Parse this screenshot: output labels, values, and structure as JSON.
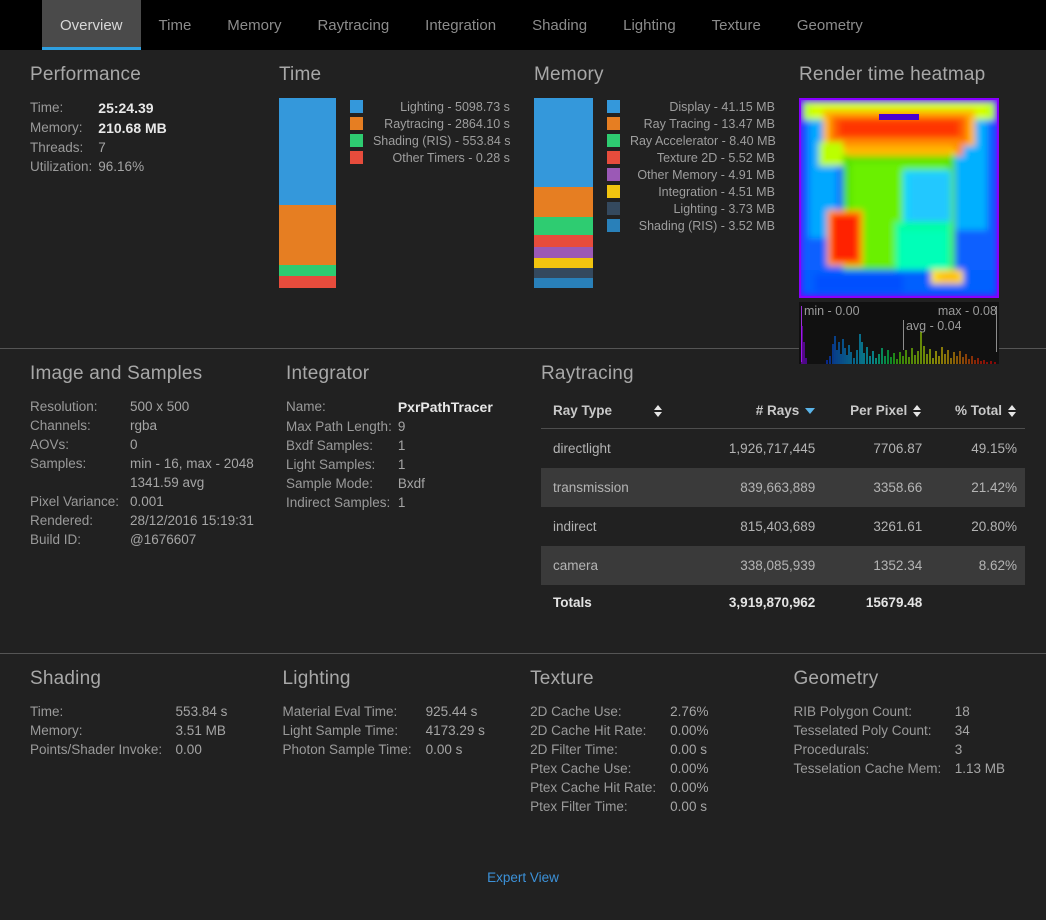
{
  "tabs": [
    {
      "label": "Overview",
      "active": true
    },
    {
      "label": "Time",
      "active": false
    },
    {
      "label": "Memory",
      "active": false
    },
    {
      "label": "Raytracing",
      "active": false
    },
    {
      "label": "Integration",
      "active": false
    },
    {
      "label": "Shading",
      "active": false
    },
    {
      "label": "Lighting",
      "active": false
    },
    {
      "label": "Texture",
      "active": false
    },
    {
      "label": "Geometry",
      "active": false
    }
  ],
  "performance": {
    "title": "Performance",
    "rows": [
      {
        "key": "Time:",
        "value": "25:24.39",
        "bold": true
      },
      {
        "key": "Memory:",
        "value": "210.68 MB",
        "bold": true
      },
      {
        "key": "Threads:",
        "value": "7",
        "bold": false
      },
      {
        "key": "Utilization:",
        "value": "96.16%",
        "bold": false
      }
    ]
  },
  "time_panel": {
    "title": "Time"
  },
  "memory_panel": {
    "title": "Memory"
  },
  "heatmap": {
    "title": "Render time heatmap",
    "min_label": "min - 0.00",
    "max_label": "max - 0.08",
    "avg_label": "avg - 0.04"
  },
  "image_samples": {
    "title": "Image and Samples",
    "rows": [
      {
        "key": "Resolution:",
        "value": "500 x 500"
      },
      {
        "key": "Channels:",
        "value": "rgba"
      },
      {
        "key": "AOVs:",
        "value": "0"
      },
      {
        "key": "Samples:",
        "value": "min - 16, max - 2048"
      },
      {
        "key": "",
        "value": "1341.59 avg"
      },
      {
        "key": "Pixel Variance:",
        "value": "0.001"
      },
      {
        "key": "Rendered:",
        "value": "28/12/2016 15:19:31"
      },
      {
        "key": "Build ID:",
        "value": "@1676607"
      }
    ]
  },
  "integrator": {
    "title": "Integrator",
    "rows": [
      {
        "key": "Name:",
        "value": "PxrPathTracer",
        "bold": true
      },
      {
        "key": "Max Path Length:",
        "value": "9",
        "bold": false
      },
      {
        "key": "Bxdf Samples:",
        "value": "1",
        "bold": false
      },
      {
        "key": "Light Samples:",
        "value": "1",
        "bold": false
      },
      {
        "key": "Sample Mode:",
        "value": "Bxdf",
        "bold": false
      },
      {
        "key": "Indirect Samples:",
        "value": "1",
        "bold": false
      }
    ]
  },
  "raytracing": {
    "title": "Raytracing",
    "columns": [
      {
        "label": "Ray Type",
        "sort": "both"
      },
      {
        "label": "# Rays",
        "sort": "desc"
      },
      {
        "label": "Per Pixel",
        "sort": "both"
      },
      {
        "label": "% Total",
        "sort": "both"
      }
    ],
    "rows": [
      {
        "ray_type": "directlight",
        "rays": "1,926,717,445",
        "per_pixel": "7706.87",
        "pct_total": "49.15%"
      },
      {
        "ray_type": "transmission",
        "rays": "839,663,889",
        "per_pixel": "3358.66",
        "pct_total": "21.42%"
      },
      {
        "ray_type": "indirect",
        "rays": "815,403,689",
        "per_pixel": "3261.61",
        "pct_total": "20.80%"
      },
      {
        "ray_type": "camera",
        "rays": "338,085,939",
        "per_pixel": "1352.34",
        "pct_total": "8.62%"
      }
    ],
    "totals": {
      "label": "Totals",
      "rays": "3,919,870,962",
      "per_pixel": "15679.48",
      "pct_total": ""
    }
  },
  "shading": {
    "title": "Shading",
    "rows": [
      {
        "key": "Time:",
        "value": "553.84 s"
      },
      {
        "key": "Memory:",
        "value": "3.51 MB"
      },
      {
        "key": "Points/Shader Invoke:",
        "value": "0.00"
      }
    ]
  },
  "lighting": {
    "title": "Lighting",
    "rows": [
      {
        "key": "Material Eval Time:",
        "value": "925.44 s"
      },
      {
        "key": "Light Sample Time:",
        "value": "4173.29 s"
      },
      {
        "key": "Photon Sample Time:",
        "value": "0.00 s"
      }
    ]
  },
  "texture": {
    "title": "Texture",
    "rows": [
      {
        "key": "2D Cache Use:",
        "value": "2.76%"
      },
      {
        "key": "2D Cache Hit Rate:",
        "value": "0.00%"
      },
      {
        "key": "2D Filter Time:",
        "value": "0.00 s"
      },
      {
        "key": "Ptex Cache Use:",
        "value": "0.00%"
      },
      {
        "key": "Ptex Cache Hit Rate:",
        "value": "0.00%"
      },
      {
        "key": "Ptex Filter Time:",
        "value": "0.00 s"
      }
    ]
  },
  "geometry": {
    "title": "Geometry",
    "rows": [
      {
        "key": "RIB Polygon Count:",
        "value": "18"
      },
      {
        "key": "Tesselated Poly Count:",
        "value": "34"
      },
      {
        "key": "Procedurals:",
        "value": "3"
      },
      {
        "key": "Tesselation Cache Mem:",
        "value": "1.13 MB"
      }
    ]
  },
  "footer": {
    "expert_view": "Expert View"
  },
  "palette": {
    "blue": "#3498db",
    "orange": "#e67e22",
    "green": "#2ecc71",
    "red": "#e74c3c",
    "purple": "#9b59b6",
    "yellow": "#f1c40f",
    "slate": "#34495e",
    "dark_blue": "#2980b9",
    "accent": "#2e9fe0",
    "link": "#3c91d8"
  },
  "chart_data": [
    {
      "type": "bar",
      "title": "Time",
      "stacked": true,
      "unit": "s",
      "categories": [
        "Lighting",
        "Raytracing",
        "Shading (RIS)",
        "Other Timers"
      ],
      "values": [
        5098.73,
        2864.1,
        553.84,
        0.28
      ],
      "labels": [
        "Lighting - 5098.73 s",
        "Raytracing - 2864.10 s",
        "Shading (RIS) - 553.84 s",
        "Other Timers - 0.28 s"
      ],
      "colors": [
        "#3498db",
        "#e67e22",
        "#2ecc71",
        "#e74c3c"
      ],
      "legend_position": "right"
    },
    {
      "type": "bar",
      "title": "Memory",
      "stacked": true,
      "unit": "MB",
      "categories": [
        "Display",
        "Ray Tracing",
        "Ray Accelerator",
        "Texture 2D",
        "Other Memory",
        "Integration",
        "Lighting",
        "Shading (RIS)"
      ],
      "values": [
        41.15,
        13.47,
        8.4,
        5.52,
        4.91,
        4.51,
        3.73,
        3.52
      ],
      "labels": [
        "Display - 41.15 MB",
        "Ray Tracing - 13.47 MB",
        "Ray Accelerator - 8.40 MB",
        "Texture 2D - 5.52 MB",
        "Other Memory - 4.91 MB",
        "Integration - 4.51 MB",
        "Lighting - 3.73 MB",
        "Shading (RIS) - 3.52 MB"
      ],
      "colors": [
        "#3498db",
        "#e67e22",
        "#2ecc71",
        "#e74c3c",
        "#9b59b6",
        "#f1c40f",
        "#34495e",
        "#2980b9"
      ],
      "legend_position": "right"
    },
    {
      "type": "heatmap",
      "title": "Render time heatmap",
      "min": 0.0,
      "max": 0.08,
      "avg": 0.04,
      "unit": "s"
    },
    {
      "type": "table",
      "title": "Raytracing",
      "columns": [
        "Ray Type",
        "# Rays",
        "Per Pixel",
        "% Total"
      ],
      "rows": [
        [
          "directlight",
          1926717445,
          7706.87,
          49.15
        ],
        [
          "transmission",
          839663889,
          3358.66,
          21.42
        ],
        [
          "indirect",
          815403689,
          3261.61,
          20.8
        ],
        [
          "camera",
          338085939,
          1352.34,
          8.62
        ]
      ],
      "totals": [
        "Totals",
        3919870962,
        15679.48,
        null
      ]
    }
  ]
}
